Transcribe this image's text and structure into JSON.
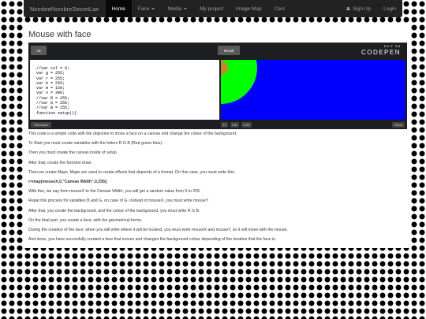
{
  "navbar": {
    "brand": "NombreNombreSecretLair",
    "items": [
      {
        "label": "Home",
        "active": true
      },
      {
        "label": "Face",
        "dropdown": true
      },
      {
        "label": "Media",
        "dropdown": true
      },
      {
        "label": "My project"
      },
      {
        "label": "Image Map"
      },
      {
        "label": "Cars"
      }
    ],
    "sign_up": "Sign Up",
    "login": "Login"
  },
  "page": {
    "title": "Mouse with face"
  },
  "codepen": {
    "js_tab": "JS",
    "result_tab": "Result",
    "edit_on": "EDIT ON",
    "brand": "CODEPEN",
    "code": "//var col = 0;\nvar g = 255;\nvar r = 255;\nvar b = 255;\nvar m = 150;\nvar n = 300;\n//var R = 255;\n//var G = 255;\n//var B = 255;\nfunction setup(){",
    "resources": "Resources",
    "zoom_1x": "1×",
    "zoom_05x": "0.5×",
    "zoom_025x": "0.25×",
    "rerun": "Rerun",
    "colors": {
      "canvas": "#0000ff",
      "shape": "#00ff00",
      "face": "#c08a2e"
    }
  },
  "article": {
    "p1": "This code is a simple code with the objective to move a face on a canvas and change the colour of the background.",
    "p2": "To Start you must create variables with the letters R G B (Red green blue).",
    "p3": "Then you must create the canvas inside of setup.",
    "p4": "After that, create the function draw.",
    "p5": "Then we create Maps. Maps are used to create effects that depends of a format. On this case, you must write this:",
    "p6": "r=map(mouseX,0,\"Canvas Width\",0,255);",
    "p7": "With this, we say from mouseX to the Canvas Width, you will get a random value from 0 to 255.",
    "p8": "Repat this process for variables B and G, on case of G, instead of mouseX, you must write mouseY.",
    "p9": "After that, you create the background, and the colour of the background, you must write R G B.",
    "p10": "On the final part, you create a face, with the geometrical forms.",
    "p11": "During the creation of the face, when you will write where it will be located, you must write mouseX and mouseY, so it will move with the mouse.",
    "p12": "And done, you have succesfully created a face that moves and changes the background colour depending of the location that the face is."
  }
}
